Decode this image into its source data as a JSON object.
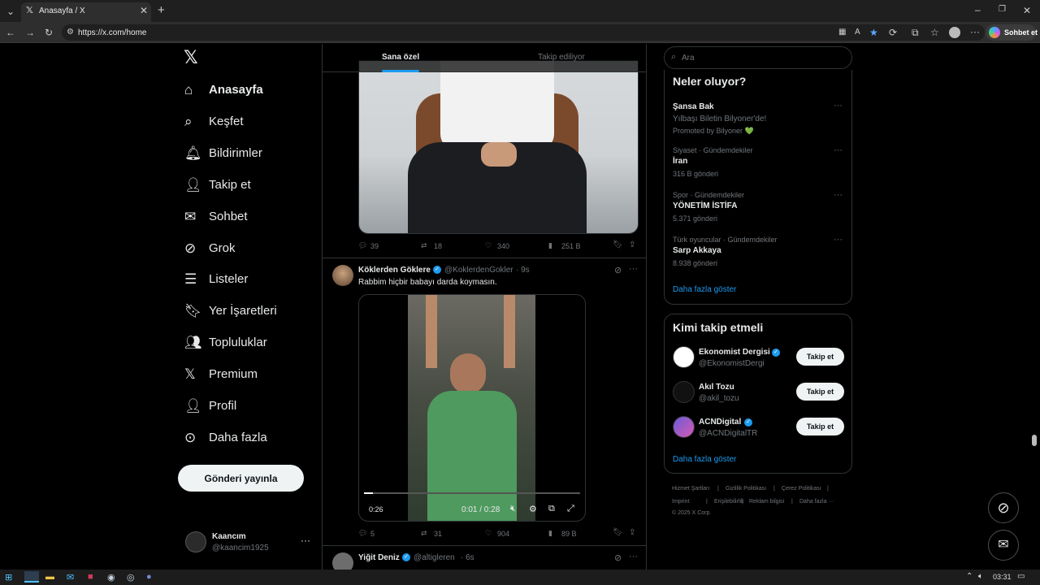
{
  "browser": {
    "tab_title": "Anasayfa / X",
    "url": "https://x.com/home",
    "sohbet_label": "Sohbet et"
  },
  "sidebar": {
    "items": [
      {
        "label": "Anasayfa",
        "icon": "home-icon"
      },
      {
        "label": "Keşfet",
        "icon": "search-icon"
      },
      {
        "label": "Bildirimler",
        "icon": "bell-icon"
      },
      {
        "label": "Takip et",
        "icon": "add-user-icon"
      },
      {
        "label": "Sohbet",
        "icon": "mail-icon"
      },
      {
        "label": "Grok",
        "icon": "grok-icon"
      },
      {
        "label": "Listeler",
        "icon": "list-icon"
      },
      {
        "label": "Yer İşaretleri",
        "icon": "bookmark-icon"
      },
      {
        "label": "Topluluklar",
        "icon": "people-icon"
      },
      {
        "label": "Premium",
        "icon": "x-logo-icon"
      },
      {
        "label": "Profil",
        "icon": "person-icon"
      },
      {
        "label": "Daha fazla",
        "icon": "more-circle-icon"
      }
    ],
    "post_button": "Gönderi yayınla",
    "account": {
      "name": "Kaancım",
      "handle": "@kaancim1925",
      "more": "···"
    }
  },
  "timeline": {
    "tabs": [
      "Sana özel",
      "Takip ediliyor"
    ],
    "post1_stats": {
      "replies": "39",
      "reposts": "18",
      "likes": "340",
      "views": "251 B"
    },
    "post2": {
      "author": "Köklerden Göklere",
      "handle": "@KoklerdenGokler",
      "time": "· 9s",
      "text": "Rabbim hiçbir babayı darda koymasın.",
      "video_left": "0:26",
      "video_time": "0:01 / 0:28",
      "video_progress": 0.04,
      "stats": {
        "replies": "5",
        "reposts": "31",
        "likes": "904",
        "views": "89 B"
      }
    },
    "post3": {
      "author": "Yiğit Deniz",
      "handle": "@altigleren",
      "time": "· 6s"
    }
  },
  "right": {
    "search_placeholder": "Ara",
    "trends_title": "Neler oluyor?",
    "trends": [
      {
        "category": "",
        "name": "Şansa Bak",
        "sub": "Yılbaşı Biletin Bilyoner'de!",
        "meta": "Promoted by Bilyoner 💚"
      },
      {
        "category": "Siyaset · Gündemdekiler",
        "name": "İran",
        "sub": "",
        "meta": "316 B gönderi"
      },
      {
        "category": "Spor · Gündemdekiler",
        "name": "YÖNETİM İSTİFA",
        "sub": "",
        "meta": "5.371 gönderi"
      },
      {
        "category": "Türk oyuncular · Gündemdekiler",
        "name": "Sarp Akkaya",
        "sub": "",
        "meta": "8.938 gönderi"
      }
    ],
    "show_more": "Daha fazla göster",
    "who_title": "Kimi takip etmeli",
    "who": [
      {
        "name": "Ekonomist Dergisi",
        "handle": "@EkonomistDergi",
        "button": "Takip et",
        "verified": true
      },
      {
        "name": "Akıl Tozu",
        "handle": "@akil_tozu",
        "button": "Takip et",
        "verified": false
      },
      {
        "name": "ACNDigital",
        "handle": "@ACNDigitalTR",
        "button": "Takip et",
        "verified": true
      }
    ],
    "footer": [
      "Hizmet Şartları",
      "|",
      "Gizlilik Politikası",
      "|",
      "Çerez Politikası",
      "|",
      "Imprint",
      "|",
      "Erişilebilirlik",
      "|",
      "Reklam bilgisi",
      "|",
      "Daha fazla ···",
      "© 2025 X Corp."
    ]
  },
  "taskbar": {
    "time": "03:31"
  },
  "colors": {
    "accent": "#1d9bf0",
    "background": "#000000",
    "text": "#e7e9ea",
    "muted": "#71767b"
  }
}
